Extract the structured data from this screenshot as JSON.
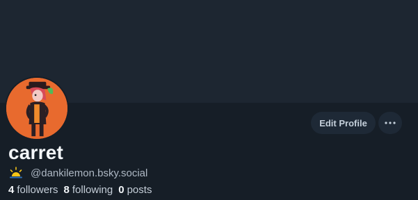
{
  "profile": {
    "display_name": "carret",
    "handle": "@dankilemon.bsky.social",
    "handle_prefix_icon": "sunrise-icon",
    "avatar_icon": "character-avatar",
    "stats": {
      "followers": {
        "count": "4",
        "label": "followers"
      },
      "following": {
        "count": "8",
        "label": "following"
      },
      "posts": {
        "count": "0",
        "label": "posts"
      }
    }
  },
  "actions": {
    "edit_profile_label": "Edit Profile",
    "more_icon": "ellipsis-icon"
  },
  "colors": {
    "background": "#161e27",
    "banner": "#1d2631",
    "button_bg": "#1e2936",
    "avatar_bg": "#e86a2e",
    "sun_accent": "#f5c518"
  }
}
